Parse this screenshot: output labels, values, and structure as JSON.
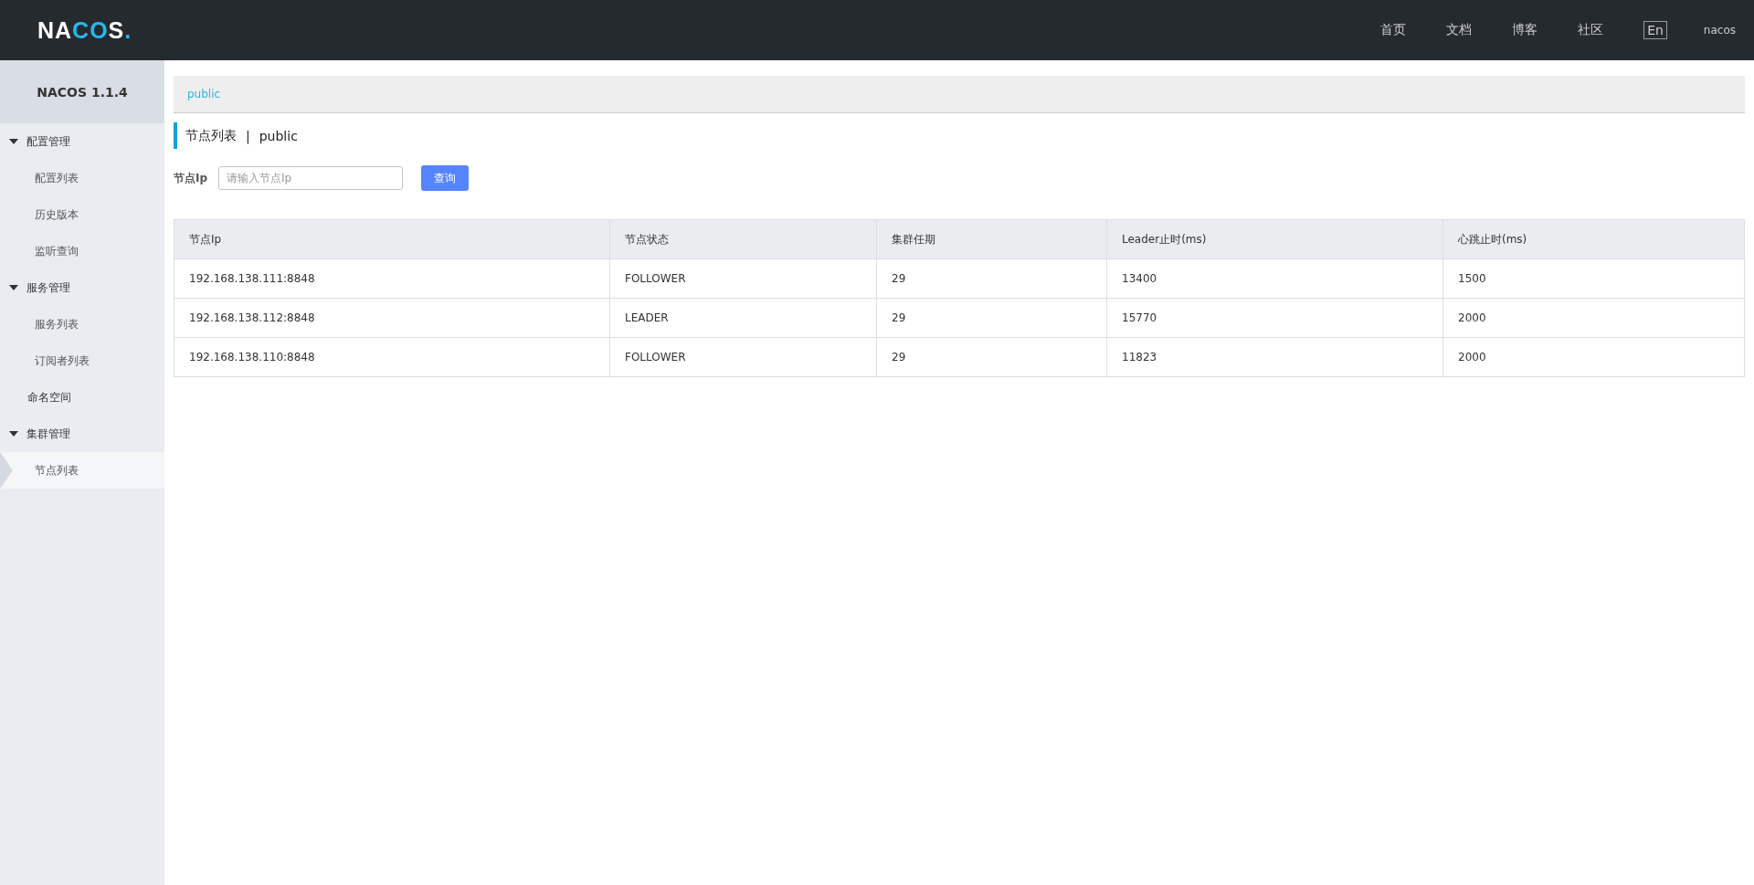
{
  "header": {
    "logo": "NACOS.",
    "nav": [
      {
        "label": "首页"
      },
      {
        "label": "文档"
      },
      {
        "label": "博客"
      },
      {
        "label": "社区"
      }
    ],
    "language": "En",
    "user": "nacos"
  },
  "sidebar": {
    "title": "NACOS 1.1.4",
    "items": [
      {
        "label": "配置管理",
        "expanded": true,
        "children": [
          {
            "label": "配置列表",
            "selected": false
          },
          {
            "label": "历史版本",
            "selected": false
          },
          {
            "label": "监听查询",
            "selected": false
          }
        ]
      },
      {
        "label": "服务管理",
        "expanded": true,
        "children": [
          {
            "label": "服务列表",
            "selected": false
          },
          {
            "label": "订阅者列表",
            "selected": false
          }
        ]
      },
      {
        "label": "命名空间",
        "selected": false
      },
      {
        "label": "集群管理",
        "expanded": true,
        "children": [
          {
            "label": "节点列表",
            "selected": true
          }
        ]
      }
    ]
  },
  "breadcrumb": "public",
  "page_title": {
    "title": "节点列表",
    "separator": "|",
    "namespace": "public"
  },
  "search": {
    "label": "节点Ip",
    "placeholder": "请输入节点Ip",
    "button": "查询"
  },
  "table": {
    "columns": [
      "节点Ip",
      "节点状态",
      "集群任期",
      "Leader止时(ms)",
      "心跳止时(ms)"
    ],
    "rows": [
      [
        "192.168.138.111:8848",
        "FOLLOWER",
        "29",
        "13400",
        "1500"
      ],
      [
        "192.168.138.112:8848",
        "LEADER",
        "29",
        "15770",
        "2000"
      ],
      [
        "192.168.138.110:8848",
        "FOLLOWER",
        "29",
        "11823",
        "2000"
      ]
    ]
  }
}
